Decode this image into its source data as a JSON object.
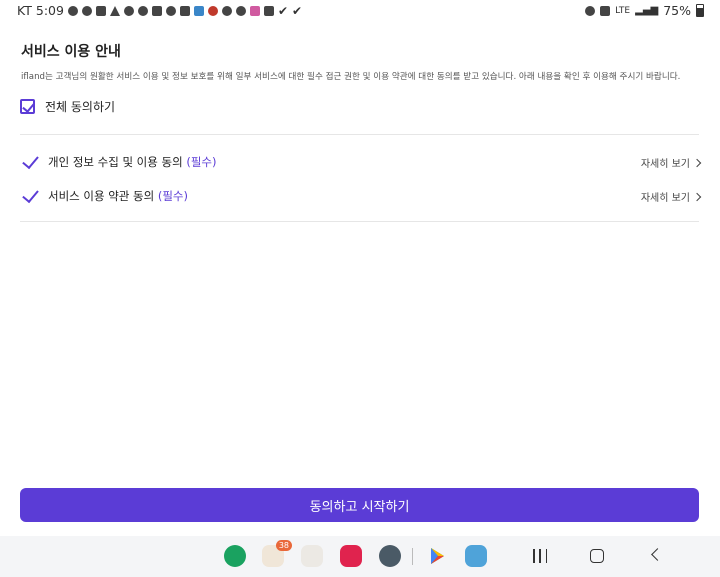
{
  "status_bar": {
    "carrier": "KT",
    "time": "5:09",
    "network": "LTE",
    "battery": "75%",
    "left_icons": [
      "chat-icon",
      "wordpress-icon",
      "wifi-calling-icon",
      "warning-icon",
      "account-icon",
      "g-circle-icon",
      "album-icon",
      "alarm-icon",
      "network-icon",
      "translate-icon",
      "bug-icon",
      "instagram-icon",
      "c-circle-icon",
      "app-icon",
      "image-icon",
      "check-icon",
      "check-icon"
    ],
    "right_icons": [
      "alarm-icon",
      "hd-voice-icon",
      "lte-icon",
      "signal-icon",
      "battery-icon"
    ]
  },
  "page": {
    "title": "서비스 이용 안내",
    "description": "ifland는 고객님의 원활한 서비스 이용 및 정보 보호를 위해 일부 서비스에 대한 필수 접근 권한 및 이용 약관에 대한 동의를 받고 있습니다. 아래 내용을 확인 후 이용해 주시기 바랍니다.",
    "agree_all_label": "전체 동의하기",
    "items": [
      {
        "label": "개인 정보 수집 및 이용 동의",
        "required": "(필수)",
        "more": "자세히 보기"
      },
      {
        "label": "서비스 이용 약관 동의",
        "required": "(필수)",
        "more": "자세히 보기"
      }
    ],
    "cta_label": "동의하고 시작하기"
  },
  "nav": {
    "apps": [
      {
        "name": "phone-app-icon",
        "color": "#1aa260"
      },
      {
        "name": "apps-folder-icon",
        "color": "#f0e6d8",
        "badge": "38"
      },
      {
        "name": "apps-folder-2-icon",
        "color": "#ece9e4"
      },
      {
        "name": "camera-app-icon",
        "color": "#e0234e"
      },
      {
        "name": "app-drawer-icon",
        "color": "#4a5a66"
      },
      {
        "name": "play-store-icon",
        "color": "#34a853"
      },
      {
        "name": "notes-app-icon",
        "color": "#4fa3d9"
      }
    ]
  },
  "colors": {
    "accent": "#5b3cd6"
  }
}
